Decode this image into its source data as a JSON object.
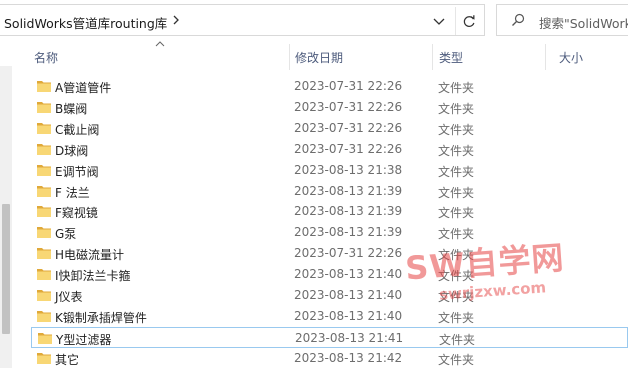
{
  "address_bar": {
    "path": "SolidWorks管道库routing库",
    "search_placeholder": "搜索\"SolidWork"
  },
  "columns": [
    {
      "label": "名称"
    },
    {
      "label": "修改日期"
    },
    {
      "label": "类型"
    },
    {
      "label": "大小"
    }
  ],
  "folders": [
    {
      "name": "A管道管件",
      "date": "2023-07-31 22:26",
      "type": "文件夹"
    },
    {
      "name": "B蝶阀",
      "date": "2023-07-31 22:26",
      "type": "文件夹"
    },
    {
      "name": "C截止阀",
      "date": "2023-07-31 22:26",
      "type": "文件夹"
    },
    {
      "name": "D球阀",
      "date": "2023-07-31 22:26",
      "type": "文件夹"
    },
    {
      "name": "E调节阀",
      "date": "2023-08-13 21:38",
      "type": "文件夹"
    },
    {
      "name": "F 法兰",
      "date": "2023-08-13 21:39",
      "type": "文件夹"
    },
    {
      "name": "F窥视镜",
      "date": "2023-08-13 21:39",
      "type": "文件夹"
    },
    {
      "name": "G泵",
      "date": "2023-08-13 21:39",
      "type": "文件夹"
    },
    {
      "name": "H电磁流量计",
      "date": "2023-07-31 22:26",
      "type": "文件夹"
    },
    {
      "name": "I快卸法兰卡箍",
      "date": "2023-08-13 21:40",
      "type": "文件夹"
    },
    {
      "name": "J仪表",
      "date": "2023-08-13 21:40",
      "type": "文件夹"
    },
    {
      "name": "K锻制承插焊管件",
      "date": "2023-08-13 21:40",
      "type": "文件夹"
    },
    {
      "name": "Y型过滤器",
      "date": "2023-08-13 21:41",
      "type": "文件夹",
      "selected": true
    },
    {
      "name": "其它",
      "date": "2023-08-13 21:42",
      "type": "文件夹"
    }
  ],
  "watermark": {
    "title": "SW自学网",
    "url": "swrjzxw.com"
  },
  "icons": {
    "folder": "folder-icon",
    "refresh": "refresh-icon",
    "search": "search-icon",
    "chevron": "chevron-right-icon",
    "dropdown": "chevron-down-icon"
  },
  "colors": {
    "folder_yellow": "#f8d775",
    "folder_dark": "#e0a93a",
    "selection_border": "#99c9ef",
    "header_text": "#4d5b7c"
  }
}
